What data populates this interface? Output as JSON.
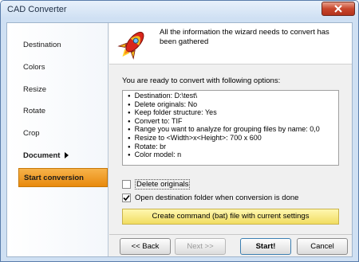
{
  "window": {
    "title": "CAD Converter"
  },
  "sidebar": {
    "items": [
      {
        "label": "Destination"
      },
      {
        "label": "Colors"
      },
      {
        "label": "Resize"
      },
      {
        "label": "Rotate"
      },
      {
        "label": "Crop"
      },
      {
        "label": "Document"
      },
      {
        "label": "Start conversion"
      }
    ]
  },
  "header": {
    "text": "All the information the wizard needs to convert has been gathered"
  },
  "main": {
    "ready_text": "You are ready to convert with following options:",
    "options": [
      "Destination: D:\\test\\",
      "Delete originals: No",
      "Keep folder structure: Yes",
      "Convert to: TIF",
      "Range you want to analyze for grouping files by name: 0,0",
      "Resize to <Width>x<Height>: 700 x 600",
      "Rotate: br",
      "Color model: n"
    ],
    "delete_originals": {
      "label": "Delete originals",
      "checked": false
    },
    "open_destination": {
      "label": "Open destination folder when conversion is done",
      "checked": true
    },
    "cmd_button": "Create command (bat) file with current settings"
  },
  "buttons": {
    "back": "<< Back",
    "next": "Next >>",
    "start": "Start!",
    "cancel": "Cancel"
  }
}
